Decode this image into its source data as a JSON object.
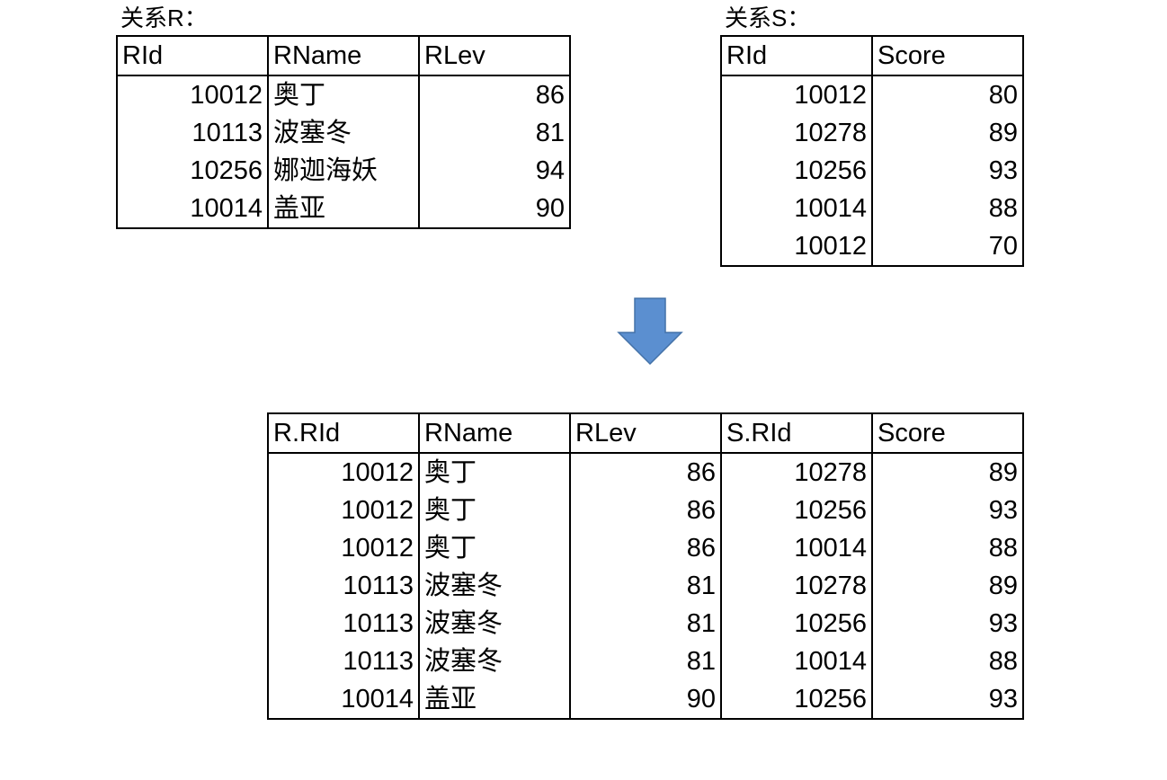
{
  "relation_r": {
    "caption": "关系R：",
    "columns": [
      "RId",
      "RName",
      "RLev"
    ],
    "rows": [
      [
        "10012",
        "奥丁",
        "86"
      ],
      [
        "10113",
        "波塞冬",
        "81"
      ],
      [
        "10256",
        "娜迦海妖",
        "94"
      ],
      [
        "10014",
        "盖亚",
        "90"
      ]
    ]
  },
  "relation_s": {
    "caption": "关系S：",
    "columns": [
      "RId",
      "Score"
    ],
    "rows": [
      [
        "10012",
        "80"
      ],
      [
        "10278",
        "89"
      ],
      [
        "10256",
        "93"
      ],
      [
        "10014",
        "88"
      ],
      [
        "10012",
        "70"
      ]
    ]
  },
  "arrow": {
    "icon": "down-arrow-icon",
    "fill": "#5b8fd0",
    "stroke": "#4472a8"
  },
  "result": {
    "columns": [
      "R.RId",
      "RName",
      "RLev",
      "S.RId",
      "Score"
    ],
    "rows": [
      [
        "10012",
        "奥丁",
        "86",
        "10278",
        "89"
      ],
      [
        "10012",
        "奥丁",
        "86",
        "10256",
        "93"
      ],
      [
        "10012",
        "奥丁",
        "86",
        "10014",
        "88"
      ],
      [
        "10113",
        "波塞冬",
        "81",
        "10278",
        "89"
      ],
      [
        "10113",
        "波塞冬",
        "81",
        "10256",
        "93"
      ],
      [
        "10113",
        "波塞冬",
        "81",
        "10014",
        "88"
      ],
      [
        "10014",
        "盖亚",
        "90",
        "10256",
        "93"
      ]
    ]
  }
}
